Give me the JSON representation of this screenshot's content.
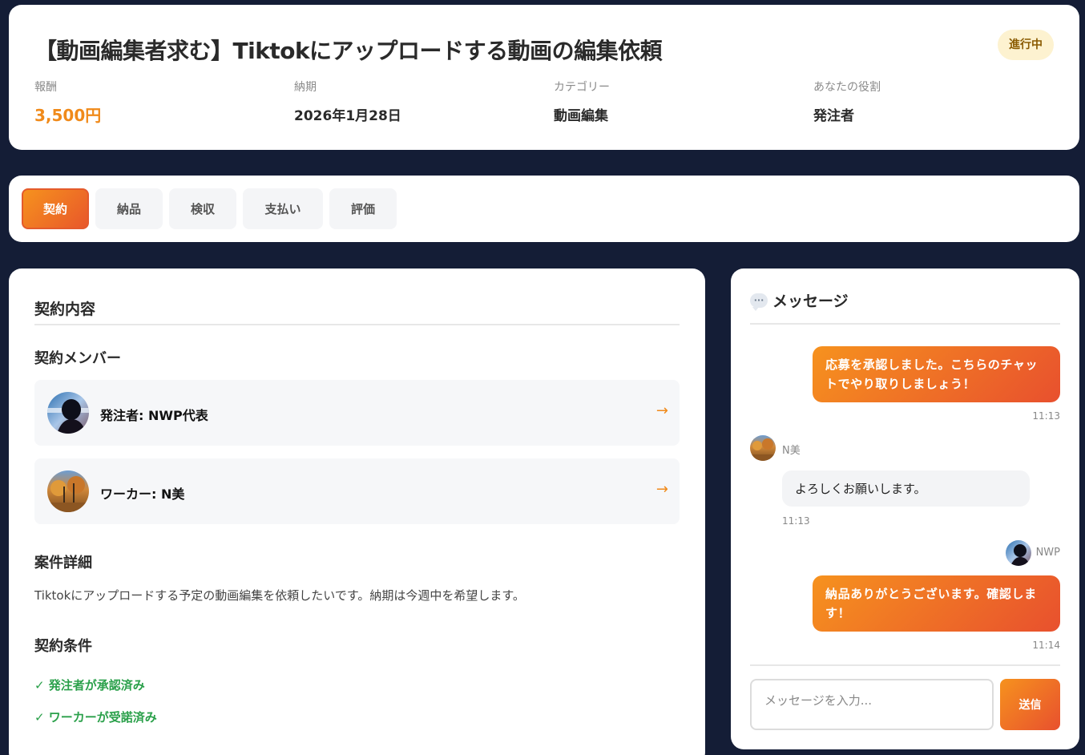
{
  "job": {
    "title": "【動画編集者求む】Tiktokにアップロードする動画の編集依頼",
    "status": "進行中",
    "meta": [
      {
        "label": "報酬",
        "value": "3,500円"
      },
      {
        "label": "納期",
        "value": "2026年1月28日"
      },
      {
        "label": "カテゴリー",
        "value": "動画編集"
      },
      {
        "label": "あなたの役割",
        "value": "発注者"
      }
    ]
  },
  "tabs": [
    "契約",
    "納品",
    "検収",
    "支払い",
    "評価"
  ],
  "active_tab": "契約",
  "contract": {
    "title": "契約内容",
    "members_title": "契約メンバー",
    "members": [
      {
        "label": "発注者: NWP代表",
        "arrow": "→",
        "avatar": "person-silhouette-avatar"
      },
      {
        "label": "ワーカー: N美",
        "arrow": "→",
        "avatar": "autumn-trees-avatar"
      }
    ],
    "details_title": "案件詳細",
    "details_text": "Tiktokにアップロードする予定の動画編集を依頼したいです。納期は今週中を希望します。",
    "conditions_title": "契約条件",
    "conditions": [
      "✓ 発注者が承認済み",
      "✓ ワーカーが受諾済み"
    ]
  },
  "chat": {
    "title": "メッセージ",
    "icon": "speech-bubble-icon",
    "messages": [
      {
        "direction": "out",
        "text": "応募を承認しました。こちらのチャットでやり取りしましょう！",
        "time": "11:13"
      },
      {
        "direction": "in",
        "sender": "N美",
        "text": "よろしくお願いします。",
        "time": "11:13"
      },
      {
        "direction": "out",
        "sender": "NWP",
        "text": "納品ありがとうございます。確認します！",
        "time": "11:14"
      }
    ],
    "input_placeholder": "メッセージを入力...",
    "send_label": "送信"
  },
  "colors": {
    "background": "#141d36",
    "accent_start": "#f6921e",
    "accent_end": "#e8502e",
    "price": "#f08a1a",
    "success": "#2aa04a",
    "status_badge_bg": "#fdf2d0"
  }
}
